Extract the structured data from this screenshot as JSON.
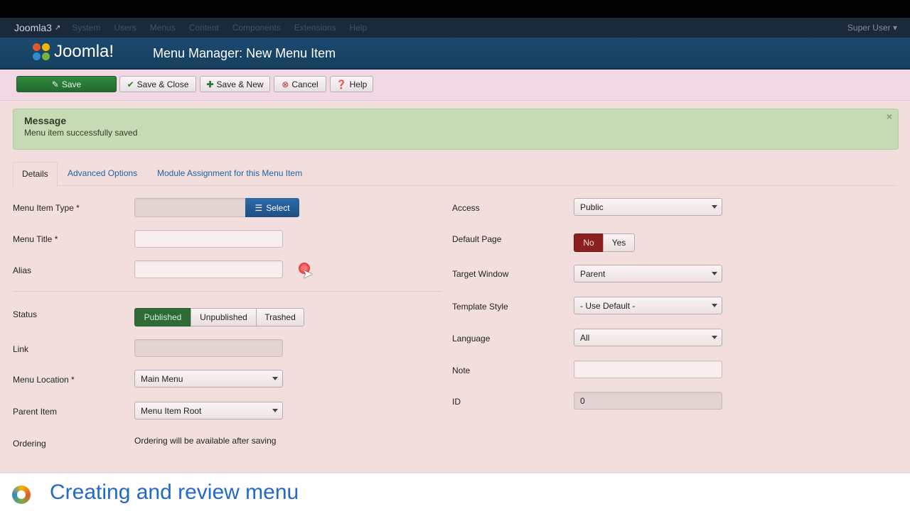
{
  "topnav": {
    "brand": "Joomla3",
    "items": [
      "System",
      "Users",
      "Menus",
      "Content",
      "Components",
      "Extensions",
      "Help"
    ],
    "user": "Super User"
  },
  "header": {
    "logo_text": "Joomla!",
    "title": "Menu Manager: New Menu Item"
  },
  "toolbar": {
    "save": "Save",
    "save_close": "Save & Close",
    "save_new": "Save & New",
    "cancel": "Cancel",
    "help": "Help"
  },
  "message": {
    "heading": "Message",
    "body": "Menu item successfully saved",
    "close": "×"
  },
  "tabs": [
    "Details",
    "Advanced Options",
    "Module Assignment for this Menu Item"
  ],
  "form_left": {
    "menu_item_type": {
      "label": "Menu Item Type *",
      "value": "",
      "button": "Select"
    },
    "menu_title": {
      "label": "Menu Title *",
      "value": ""
    },
    "alias": {
      "label": "Alias",
      "value": ""
    },
    "status": {
      "label": "Status",
      "options": [
        "Published",
        "Unpublished",
        "Trashed"
      ],
      "selected": "Published"
    },
    "link": {
      "label": "Link",
      "value": ""
    },
    "menu_location": {
      "label": "Menu Location *",
      "value": "Main Menu"
    },
    "parent_item": {
      "label": "Parent Item",
      "value": "Menu Item Root"
    },
    "ordering": {
      "label": "Ordering",
      "value": "Ordering will be available after saving"
    }
  },
  "form_right": {
    "access": {
      "label": "Access",
      "value": "Public"
    },
    "default_page": {
      "label": "Default Page",
      "options": [
        "No",
        "Yes"
      ],
      "selected": "No"
    },
    "target_window": {
      "label": "Target Window",
      "value": "Parent"
    },
    "template_style": {
      "label": "Template Style",
      "value": "- Use Default -"
    },
    "language": {
      "label": "Language",
      "value": "All"
    },
    "note": {
      "label": "Note",
      "value": ""
    },
    "id": {
      "label": "ID",
      "value": "0"
    }
  },
  "footer": {
    "caption": "Creating and review menu"
  },
  "colors": {
    "nav_bg": "#1a2a3b",
    "header_bg": "#1b4970",
    "page_bg": "#f3dede",
    "save_green": "#2f8a3e",
    "published_green": "#2e6b35",
    "no_red": "#8a2020",
    "message_green": "#c6dbb3",
    "link_blue": "#1d63a3"
  }
}
